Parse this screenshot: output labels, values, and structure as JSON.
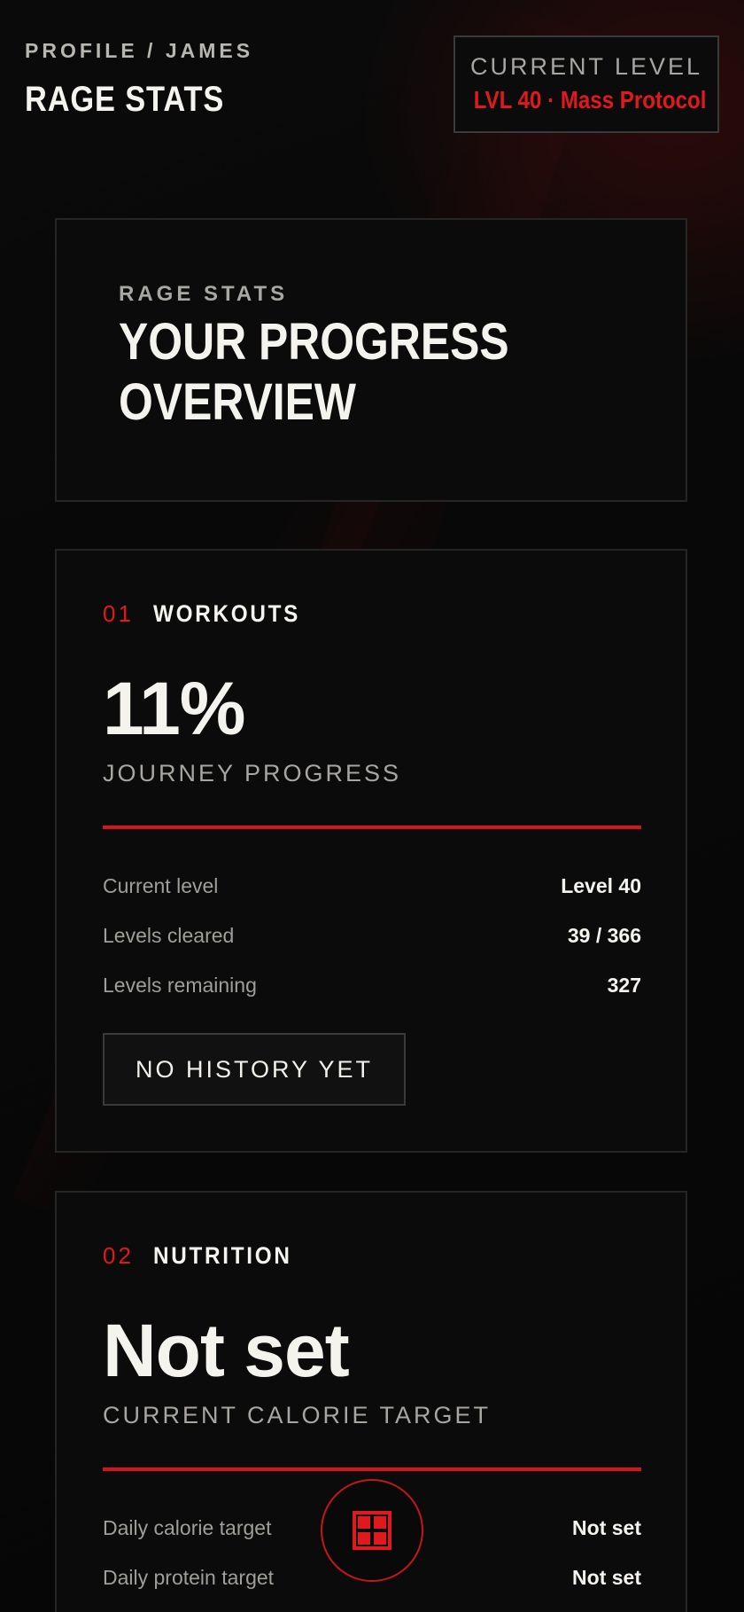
{
  "header": {
    "breadcrumb": "PROFILE / JAMES",
    "title": "RAGE STATS",
    "level_label": "CURRENT LEVEL",
    "level_value": "LVL 40 · Mass Protocol"
  },
  "hero": {
    "eyebrow": "RAGE STATS",
    "title": "YOUR PROGRESS OVERVIEW"
  },
  "workouts": {
    "number": "01",
    "title": "WORKOUTS",
    "big_value": "11%",
    "big_label": "JOURNEY PROGRESS",
    "rows": [
      {
        "label": "Current level",
        "value": "Level 40"
      },
      {
        "label": "Levels cleared",
        "value": "39 / 366"
      },
      {
        "label": "Levels remaining",
        "value": "327"
      }
    ],
    "button_label": "NO HISTORY YET"
  },
  "nutrition": {
    "number": "02",
    "title": "NUTRITION",
    "big_value": "Not set",
    "big_label": "CURRENT CALORIE TARGET",
    "rows": [
      {
        "label": "Daily calorie target",
        "value": "Not set"
      },
      {
        "label": "Daily protein target",
        "value": "Not set"
      }
    ]
  },
  "fab": {
    "icon": "grid-icon"
  },
  "colors": {
    "accent": "#e0191f",
    "background": "#070707",
    "card": "#0b0b0b",
    "text": "#f5f3ee",
    "muted": "#a8a6a0"
  }
}
